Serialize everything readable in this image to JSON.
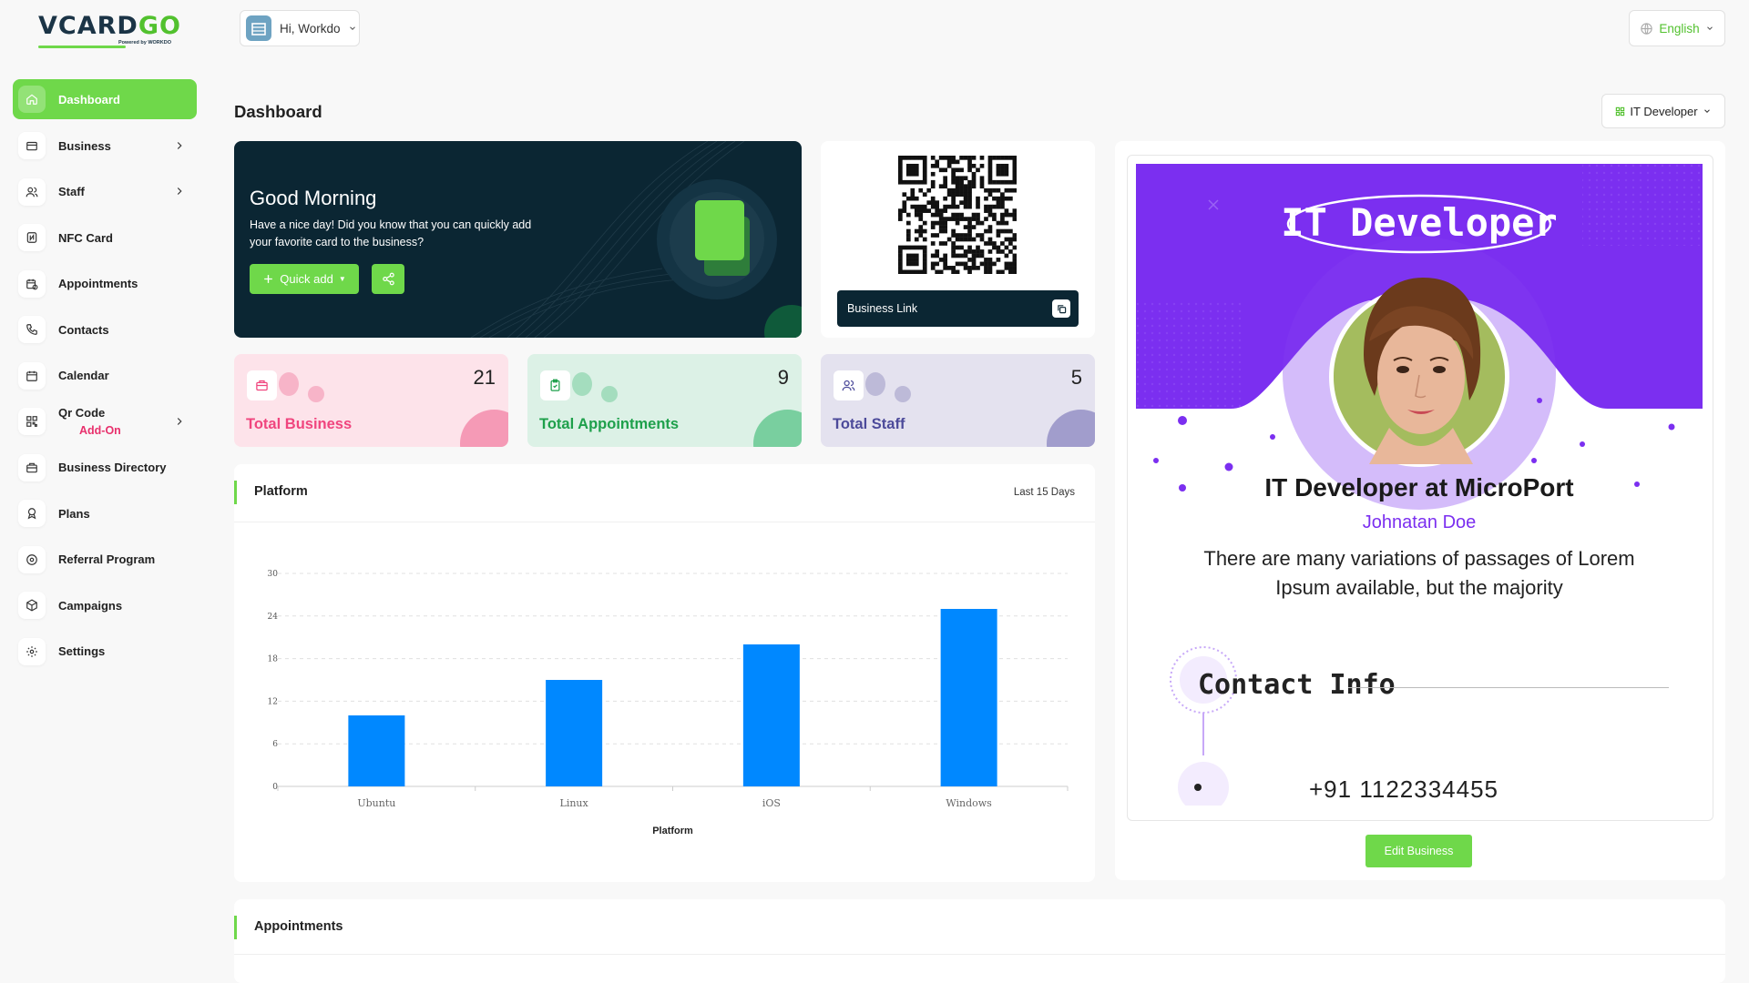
{
  "logo": {
    "part1": "VCARD",
    "part2": "GO",
    "tagline": "Powered by WORKDO"
  },
  "sidebar": {
    "items": [
      {
        "label": "Dashboard",
        "icon": "home-icon"
      },
      {
        "label": "Business",
        "icon": "business-icon"
      },
      {
        "label": "Staff",
        "icon": "users-icon"
      },
      {
        "label": "NFC Card",
        "icon": "nfc-icon"
      },
      {
        "label": "Appointments",
        "icon": "calendar-clock-icon"
      },
      {
        "label": "Contacts",
        "icon": "phone-icon"
      },
      {
        "label": "Calendar",
        "icon": "calendar-icon"
      },
      {
        "label": "Qr Code",
        "icon": "qrcode-icon",
        "badge": "Add-On"
      },
      {
        "label": "Business Directory",
        "icon": "directory-icon"
      },
      {
        "label": "Plans",
        "icon": "award-icon"
      },
      {
        "label": "Referral Program",
        "icon": "referral-icon"
      },
      {
        "label": "Campaigns",
        "icon": "box-icon"
      },
      {
        "label": "Settings",
        "icon": "gear-icon"
      }
    ]
  },
  "header": {
    "greeting": "Hi, Workdo",
    "language": "English"
  },
  "page": {
    "title": "Dashboard",
    "business_select": "IT Developer"
  },
  "welcome": {
    "title": "Good Morning",
    "text": "Have a nice day! Did you know that you can quickly add your favorite card to the business?",
    "quick_add": "Quick add"
  },
  "qr": {
    "business_link": "Business Link"
  },
  "stats": [
    {
      "label": "Total Business",
      "value": "21",
      "color": "#f0457e",
      "bg": "#fde3ea",
      "bubble": "#f7b4c8",
      "corner": "#f59ab6"
    },
    {
      "label": "Total Appointments",
      "value": "9",
      "color": "#1ea04b",
      "bg": "#dcf1e6",
      "bubble": "#a4ddbe",
      "corner": "#79cf9f"
    },
    {
      "label": "Total Staff",
      "value": "5",
      "color": "#4c4a9a",
      "bg": "#e4e2ef",
      "bubble": "#bdbad8",
      "corner": "#a19dcc"
    }
  ],
  "platform_card": {
    "title": "Platform",
    "range": "Last 15 Days"
  },
  "chart_data": {
    "type": "bar",
    "categories": [
      "Ubuntu",
      "Linux",
      "iOS",
      "Windows"
    ],
    "values": [
      10,
      15,
      20,
      25
    ],
    "xlabel": "Platform",
    "ylabel": "",
    "ylim": [
      0,
      30
    ],
    "yticks": [
      0,
      6,
      12,
      18,
      24,
      30
    ],
    "color": "#0088ff",
    "grid": true
  },
  "appointments_card": {
    "title": "Appointments"
  },
  "profile": {
    "banner_title": "IT Developer",
    "headline": "IT Developer at MicroPort",
    "name": "Johnatan Doe",
    "description": "There are many variations of passages of Lorem Ipsum available, but the majority",
    "contact_title": "Contact Info",
    "phone": "+91 1122334455",
    "edit_button": "Edit Business",
    "accent": "#7b2ff0"
  }
}
